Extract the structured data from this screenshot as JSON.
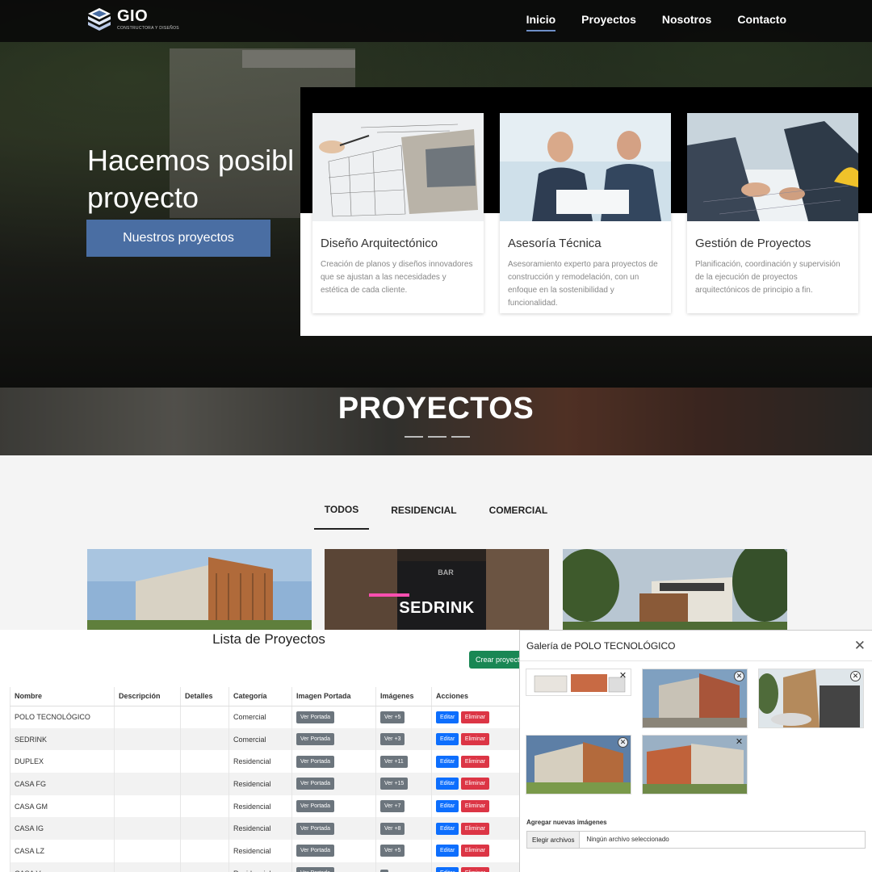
{
  "brand": {
    "name": "GIO",
    "tagline": "CONSTRUCTORA Y DISEÑOS"
  },
  "nav": [
    {
      "label": "Inicio",
      "active": true
    },
    {
      "label": "Proyectos",
      "active": false
    },
    {
      "label": "Nosotros",
      "active": false
    },
    {
      "label": "Contacto",
      "active": false
    }
  ],
  "hero": {
    "title_line1": "Hacemos posibl",
    "title_line2": "proyecto",
    "cta": "Nuestros proyectos"
  },
  "services": [
    {
      "title": "Diseño Arquitectónico",
      "text": "Creación de planos y diseños innovadores que se ajustan a las necesidades y estética de cada cliente."
    },
    {
      "title": "Asesoría Técnica",
      "text": "Asesoramiento experto para proyectos de construcción y remodelación, con un enfoque en la sostenibilidad y funcionalidad."
    },
    {
      "title": "Gestión de Proyectos",
      "text": "Planificación, coordinación y supervisión de la ejecución de proyectos arquitectónicos de principio a fin."
    }
  ],
  "projects_section": {
    "heading": "PROYECTOS",
    "filters": [
      {
        "label": "TODOS",
        "active": true
      },
      {
        "label": "RESIDENCIAL",
        "active": false
      },
      {
        "label": "COMERCIAL",
        "active": false
      }
    ],
    "tiles": [
      {
        "label": ""
      },
      {
        "label": "SEDRINK",
        "sign": "BAR"
      },
      {
        "label": ""
      }
    ]
  },
  "admin": {
    "title": "Lista de Proyectos",
    "create_button": "Crear proyecto",
    "columns": [
      "Nombre",
      "Descripción",
      "Detalles",
      "Categoría",
      "Imagen Portada",
      "Imágenes",
      "Acciones"
    ],
    "portada_btn": "Ver Portada",
    "edit_btn": "Editar",
    "delete_btn": "Eliminar",
    "rows": [
      {
        "name": "POLO TECNOLÓGICO",
        "category": "Comercial",
        "images": "Ver +5"
      },
      {
        "name": "SEDRINK",
        "category": "Comercial",
        "images": "Ver +3"
      },
      {
        "name": "DUPLEX",
        "category": "Residencial",
        "images": "Ver +11"
      },
      {
        "name": "CASA FG",
        "category": "Residencial",
        "images": "Ver +15"
      },
      {
        "name": "CASA GM",
        "category": "Residencial",
        "images": "Ver +7"
      },
      {
        "name": "CASA IG",
        "category": "Residencial",
        "images": "Ver +8"
      },
      {
        "name": "CASA LZ",
        "category": "Residencial",
        "images": "Ver +5"
      },
      {
        "name": "CASA V",
        "category": "Residencial",
        "images": ""
      }
    ]
  },
  "gallery": {
    "title": "Galería de POLO TECNOLÓGICO",
    "close_icon": "close-icon",
    "add_label": "Agregar nuevas imágenes",
    "file_button": "Elegir archivos",
    "file_status": "Ningún archivo seleccionado"
  },
  "colors": {
    "nav_active": "#6e8fc7",
    "cta": "#4a6ea3",
    "create": "#198754",
    "edit": "#0d6efd",
    "delete": "#dc3545",
    "neutral": "#6c757d"
  }
}
